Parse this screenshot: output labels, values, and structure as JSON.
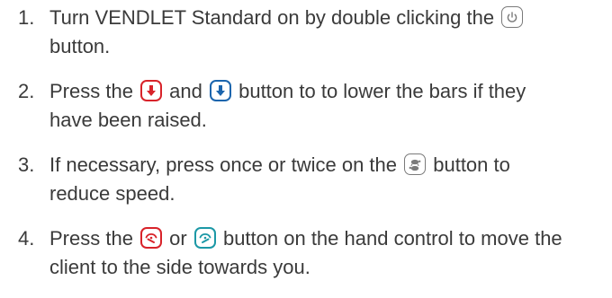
{
  "steps": [
    {
      "number": "1.",
      "lines": [
        {
          "before": "Turn VENDLET Standard on by double clicking the ",
          "after": ""
        },
        {
          "text": "button."
        }
      ]
    },
    {
      "number": "2.",
      "lines": [
        {
          "before": "Press the ",
          "middle": " and ",
          "after": " button to to lower the bars if they"
        },
        {
          "text": "have been raised."
        }
      ]
    },
    {
      "number": "3.",
      "lines": [
        {
          "before": "If necessary, press once or twice on the  ",
          "after": " button to"
        },
        {
          "text": "reduce speed."
        }
      ]
    },
    {
      "number": "4.",
      "lines": [
        {
          "before": "Press the ",
          "middle": " or ",
          "after": " button on the hand control to move the"
        },
        {
          "text": "client to the side towards you."
        }
      ]
    }
  ],
  "icons": {
    "power": "power-icon",
    "lower_red": "lower-bars-red-icon",
    "lower_blue": "lower-bars-blue-icon",
    "speed": "turtle-speed-icon",
    "turn_left": "turn-side-left-icon",
    "turn_right": "turn-side-right-icon"
  },
  "colors": {
    "text": "#3a3a3a",
    "red": "#d8232a",
    "blue": "#1b65ad",
    "teal": "#1c98a6",
    "grey": "#7a7a7a"
  }
}
